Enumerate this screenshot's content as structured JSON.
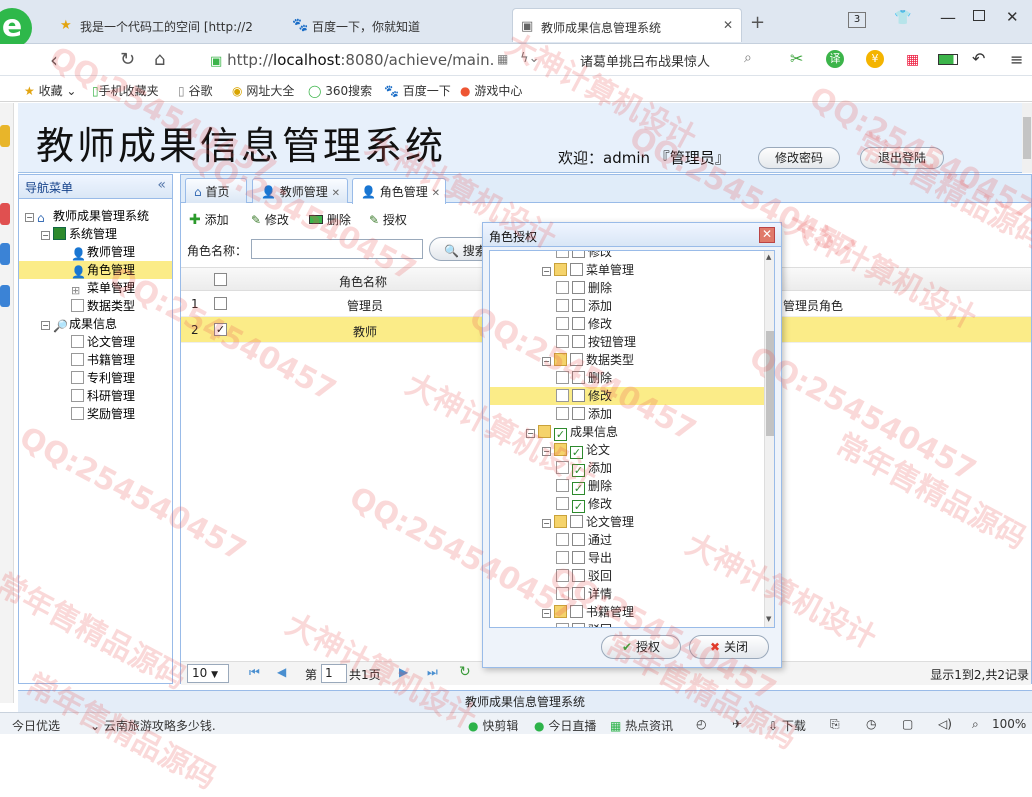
{
  "browser": {
    "tabs": [
      {
        "label": "我是一个代码工的空间 [http://2"
      },
      {
        "label": "百度一下，你就知道"
      },
      {
        "label": "教师成果信息管理系统"
      }
    ],
    "tab_count": "3",
    "url_prefix": "http://",
    "url_host": "localhost",
    "url_rest": ":8080/achieve/main.",
    "search_text": "诸葛单挑吕布战果惊人",
    "bookmarks": [
      "收藏",
      "手机收藏夹",
      "谷歌",
      "网址大全",
      "360搜索",
      "百度一下",
      "游戏中心"
    ]
  },
  "app": {
    "title": "教师成果信息管理系统",
    "welcome": "欢迎：admin 『管理员』",
    "change_password": "修改密码",
    "logout": "退出登陆",
    "footer": "教师成果信息管理系统"
  },
  "sidebar": {
    "title": "导航菜单",
    "root": "教师成果管理系统",
    "groups": [
      {
        "label": "系统管理",
        "items": [
          "教师管理",
          "角色管理",
          "菜单管理",
          "数据类型"
        ]
      },
      {
        "label": "成果信息",
        "items": [
          "论文管理",
          "书籍管理",
          "专利管理",
          "科研管理",
          "奖励管理"
        ]
      }
    ]
  },
  "main": {
    "tabs": [
      "首页",
      "教师管理",
      "角色管理"
    ],
    "toolbar": {
      "add": "添加",
      "edit": "修改",
      "delete": "删除",
      "grant": "授权"
    },
    "search_label": "角色名称：",
    "search_button": "搜索",
    "grid": {
      "header_name": "角色名称",
      "rows": [
        {
          "num": "1",
          "name": "管理员",
          "desc": "管理员角色",
          "checked": false
        },
        {
          "num": "2",
          "name": "教师",
          "desc": "",
          "checked": true
        }
      ]
    },
    "pager": {
      "page_size": "10",
      "page_label": "第",
      "page": "1",
      "total_pages": "共1页",
      "summary": "显示1到2,共2记录"
    }
  },
  "dialog": {
    "title": "角色授权",
    "nodes": [
      {
        "level": 1,
        "label": "修改",
        "type": "leaf",
        "checked": false
      },
      {
        "level": 0,
        "label": "菜单管理",
        "type": "branch",
        "checked": false
      },
      {
        "level": 1,
        "label": "删除",
        "type": "leaf",
        "checked": false
      },
      {
        "level": 1,
        "label": "添加",
        "type": "leaf",
        "checked": false
      },
      {
        "level": 1,
        "label": "修改",
        "type": "leaf",
        "checked": false
      },
      {
        "level": 1,
        "label": "按钮管理",
        "type": "leaf",
        "checked": false
      },
      {
        "level": 0,
        "label": "数据类型",
        "type": "branch",
        "checked": false
      },
      {
        "level": 1,
        "label": "删除",
        "type": "leaf",
        "checked": false
      },
      {
        "level": 1,
        "label": "修改",
        "type": "leaf",
        "checked": false,
        "highlight": true
      },
      {
        "level": 1,
        "label": "添加",
        "type": "leaf",
        "checked": false
      },
      {
        "level": -1,
        "label": "成果信息",
        "type": "root",
        "checked": true
      },
      {
        "level": 0,
        "label": "论文",
        "type": "branch",
        "checked": true
      },
      {
        "level": 1,
        "label": "添加",
        "type": "leaf",
        "checked": true
      },
      {
        "level": 1,
        "label": "删除",
        "type": "leaf",
        "checked": true
      },
      {
        "level": 1,
        "label": "修改",
        "type": "leaf",
        "checked": true
      },
      {
        "level": 0,
        "label": "论文管理",
        "type": "branch",
        "checked": false
      },
      {
        "level": 1,
        "label": "通过",
        "type": "leaf",
        "checked": false
      },
      {
        "level": 1,
        "label": "导出",
        "type": "leaf",
        "checked": false
      },
      {
        "level": 1,
        "label": "驳回",
        "type": "leaf",
        "checked": false
      },
      {
        "level": 1,
        "label": "详情",
        "type": "leaf",
        "checked": false
      },
      {
        "level": 0,
        "label": "书籍管理",
        "type": "branch",
        "checked": false
      },
      {
        "level": 1,
        "label": "驳回",
        "type": "leaf",
        "checked": false
      }
    ],
    "grant_button": "授权",
    "close_button": "关闭"
  },
  "statusbar": {
    "items": [
      "今日优选",
      "云南旅游攻略多少钱.",
      "快剪辑",
      "今日直播",
      "热点资讯",
      "下载",
      "100%"
    ]
  },
  "watermarks": [
    "QQ:254540457",
    "大神计算机设计",
    "常年售精品源码"
  ]
}
